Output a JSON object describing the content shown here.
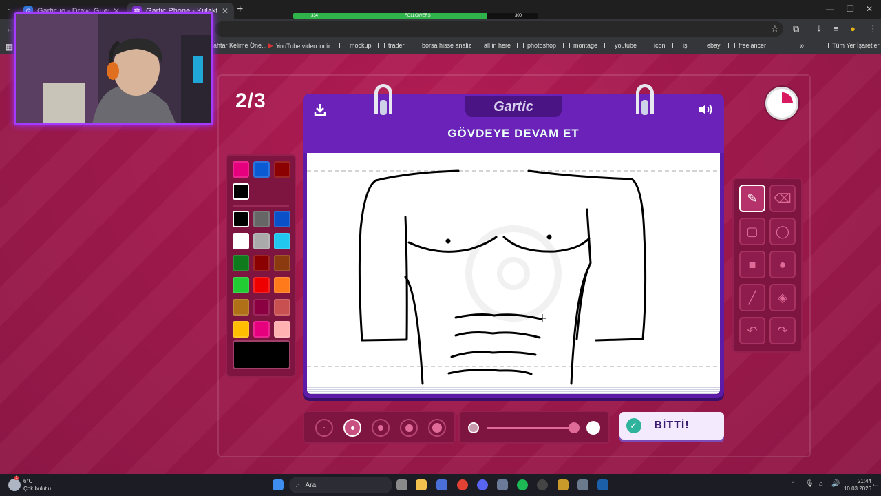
{
  "browser": {
    "tabs": [
      {
        "title": "Gartic.io - Draw, Guess, WIN",
        "favicon": "G",
        "active": false
      },
      {
        "title": "Gartic Phone - Kulaktan Kulağa",
        "favicon": "☎",
        "active": true
      }
    ],
    "new_tab_icon": "plus-icon",
    "followers_bar": {
      "left_value": "334",
      "label": "FOLLOWERS",
      "right_value": "300",
      "progress": 0.79
    },
    "bookmarks": [
      "ahtar Kelime Öne...",
      "YouTube video indir...",
      "mockup",
      "trader",
      "borsa hisse analiz",
      "all in here",
      "photoshop",
      "montage",
      "youtube",
      "icon",
      "iş",
      "ebay",
      "freelancer"
    ],
    "bookmarks_overflow": "»",
    "all_bookmarks": "Tüm Yer İşaretleri"
  },
  "game": {
    "round": "2/3",
    "logo": "Gartic",
    "prompt": "GÖVDEYE DEVAM ET",
    "done_label": "BİTTİ!",
    "timer_elapsed": 0.25,
    "palette": {
      "recent": [
        "#e6007e",
        "#0a5ad4",
        "#8b0000"
      ],
      "current_recent": "#000000",
      "colors": [
        [
          "#000000",
          "#666666",
          "#0a50c8"
        ],
        [
          "#ffffff",
          "#aaaaaa",
          "#22c7f0"
        ],
        [
          "#0f7a1c",
          "#8b0000",
          "#8b3a0f"
        ],
        [
          "#22cc33",
          "#ee0000",
          "#ff7a1a"
        ],
        [
          "#b07018",
          "#8a0040",
          "#c85050"
        ],
        [
          "#ffbf00",
          "#e6007e",
          "#ffb0b0"
        ]
      ],
      "selected": "#000000"
    },
    "tools": [
      [
        "pencil-icon",
        "eraser-icon"
      ],
      [
        "rectangle-outline-icon",
        "ellipse-outline-icon"
      ],
      [
        "rectangle-fill-icon",
        "ellipse-fill-icon"
      ],
      [
        "line-icon",
        "fill-bucket-icon"
      ],
      [
        "undo-icon",
        "redo-icon"
      ]
    ],
    "selected_tool": "pencil-icon",
    "brush_sizes": 5,
    "selected_size_index": 1,
    "opacity_level": 0.97
  },
  "taskbar": {
    "weather_temp": "6°C",
    "weather_desc": "Çok bulutlu",
    "weather_badge": "1",
    "search_label": "Ara",
    "time": "21:44",
    "date": "10.03.2026"
  }
}
